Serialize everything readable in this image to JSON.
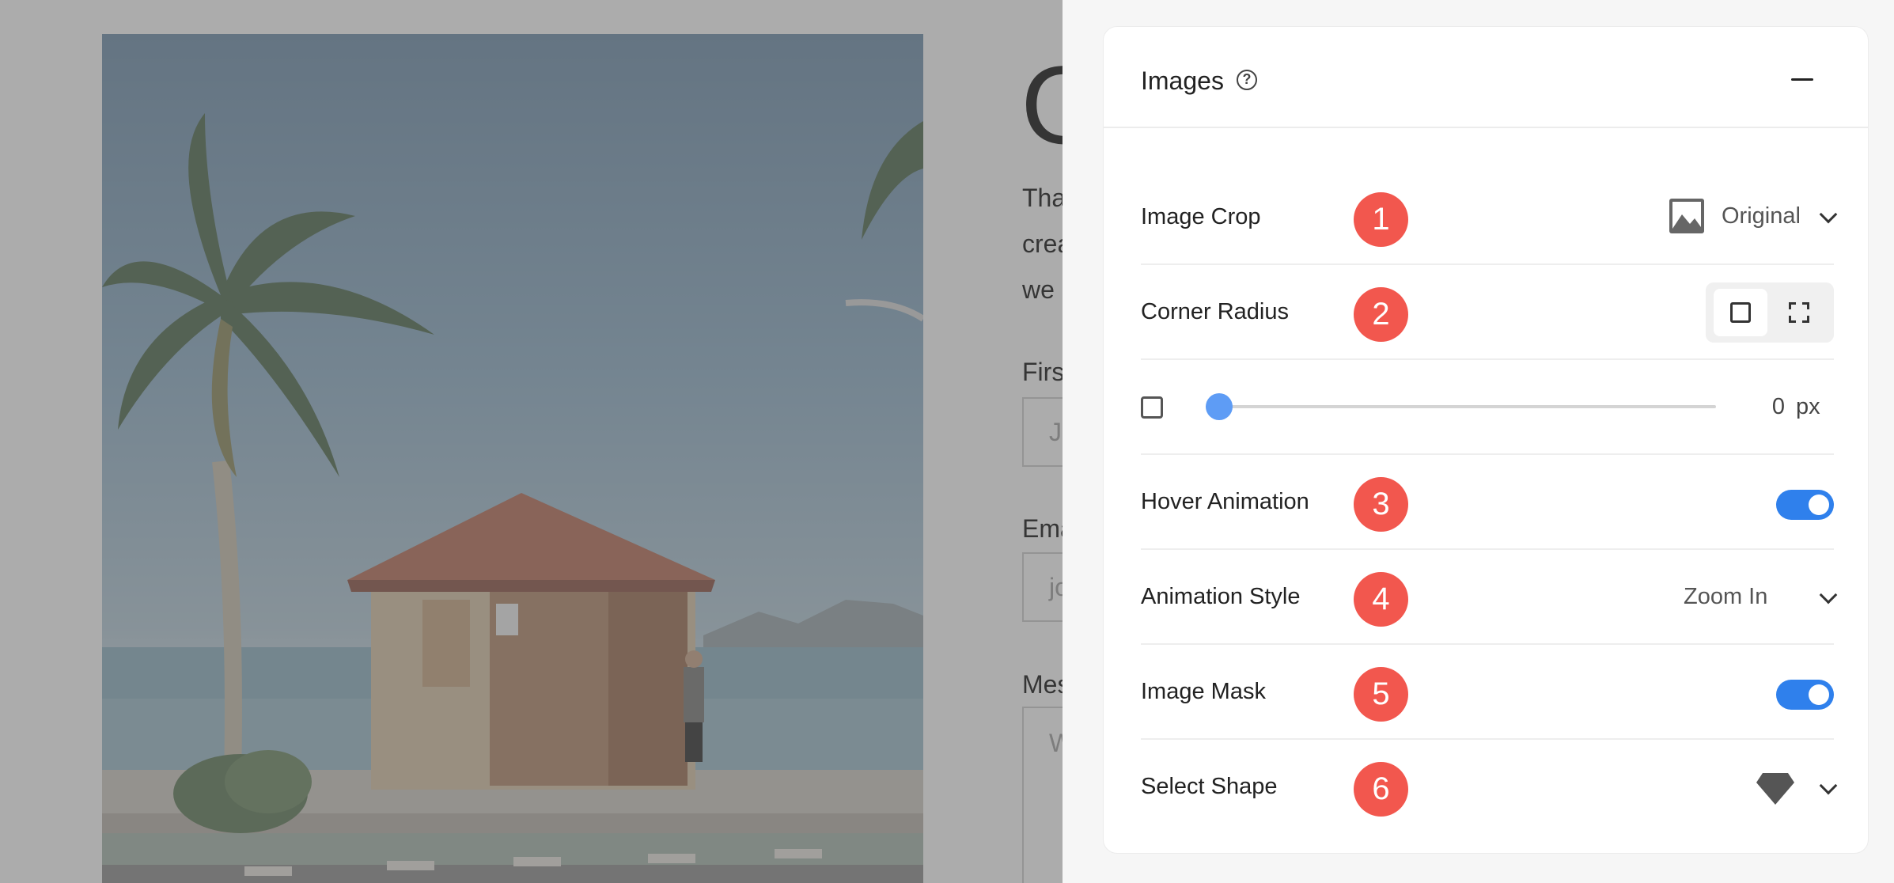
{
  "preview": {
    "heading_fragment": "G",
    "paragraph_lines": [
      "Tha",
      "crea",
      "we"
    ],
    "fields": [
      {
        "label": "Firs",
        "placeholder": "J"
      },
      {
        "label": "Ema",
        "placeholder": "jo"
      },
      {
        "label": "Mes",
        "placeholder": "W"
      }
    ]
  },
  "panel": {
    "title": "Images",
    "help_icon": "question-circle-icon",
    "collapse_icon": "minus-icon",
    "rows": {
      "image_crop": {
        "label": "Image Crop",
        "badge": "1",
        "value": "Original",
        "icon": "image-icon"
      },
      "corner_radius": {
        "label": "Corner Radius",
        "badge": "2",
        "options": [
          "uniform-corners-icon",
          "individual-corners-icon"
        ],
        "selected": "uniform-corners-icon"
      },
      "radius_slider": {
        "value": "0",
        "unit": "px",
        "min": 0,
        "max": 100,
        "level": 0
      },
      "hover_animation": {
        "label": "Hover Animation",
        "badge": "3",
        "enabled": true
      },
      "animation_style": {
        "label": "Animation Style",
        "badge": "4",
        "value": "Zoom In"
      },
      "image_mask": {
        "label": "Image Mask",
        "badge": "5",
        "enabled": true
      },
      "select_shape": {
        "label": "Select Shape",
        "badge": "6",
        "icon": "diamond-shape-icon"
      }
    }
  },
  "colors": {
    "badge": "#f2574e",
    "toggle_on": "#2f80ec",
    "slider_thumb": "#5e9cf5"
  }
}
